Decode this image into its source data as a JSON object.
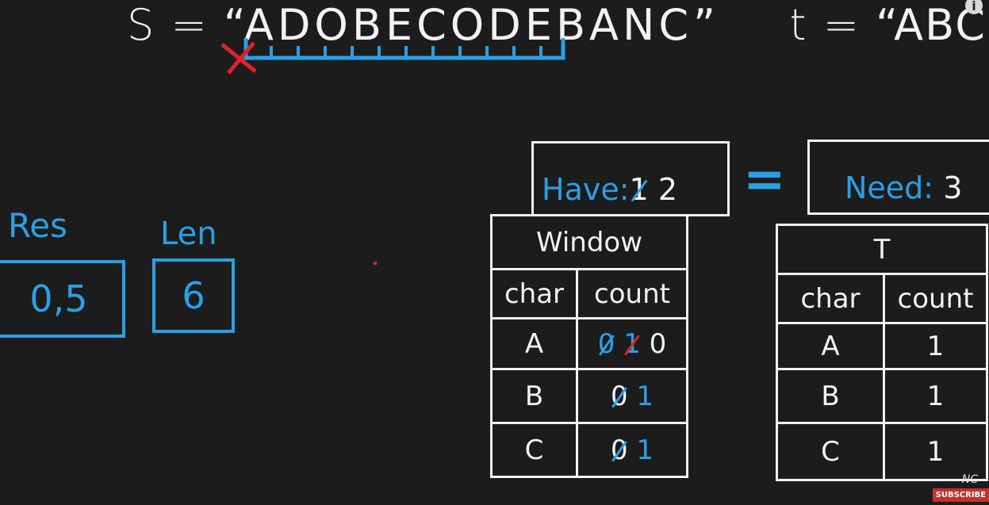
{
  "top": {
    "s_label": "S = ",
    "s_value": "“ADOBECODEBANC”",
    "t_label": "t = ",
    "t_value": "“ABC”"
  },
  "have": {
    "label": "Have:",
    "old_value": "1",
    "value": "2"
  },
  "equals": "=",
  "need": {
    "label": "Need:",
    "value": "3"
  },
  "res": {
    "label": "Res",
    "value": "0,5"
  },
  "len": {
    "label": "Len",
    "value": "6"
  },
  "window_table": {
    "title": "Window",
    "headers": [
      "char",
      "count"
    ],
    "rows": [
      {
        "char": "A",
        "old": [
          "0",
          "1"
        ],
        "count": "0"
      },
      {
        "char": "B",
        "old": [
          "0"
        ],
        "count": "1"
      },
      {
        "char": "C",
        "old": [
          "0"
        ],
        "count": "1"
      }
    ]
  },
  "t_table": {
    "title": "T",
    "headers": [
      "char",
      "count"
    ],
    "rows": [
      {
        "char": "A",
        "count": "1"
      },
      {
        "char": "B",
        "count": "1"
      },
      {
        "char": "C",
        "count": "1"
      }
    ]
  },
  "overlay": {
    "info": "i",
    "subscribe": "SUBSCRIBE",
    "channel_mark": "NC"
  },
  "colors": {
    "background": "#1c1c1c",
    "chalk": "#f2f2f2",
    "marker_blue": "#2aa0e6",
    "marker_red": "#e0222a"
  }
}
